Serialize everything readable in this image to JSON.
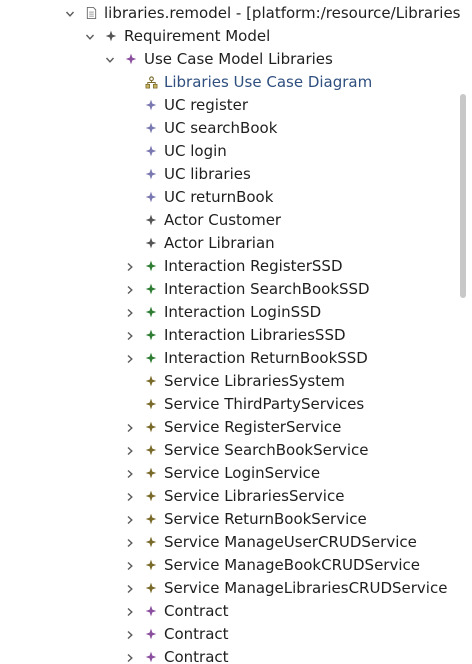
{
  "colors": {
    "interaction_icon": "#2e7d32",
    "service_icon": "#7a6a2a",
    "contract_icon": "#8a4f9e",
    "uc_icon": "#7a78b0",
    "actor_icon": "#555555",
    "diagram_text": "#2f4f7f"
  },
  "tree": {
    "rows": [
      {
        "label": "libraries.remodel - [platform:/resource/Libraries",
        "depth": 0,
        "expander": "expanded",
        "icon": "file-icon"
      },
      {
        "label": "Requirement Model",
        "depth": 1,
        "expander": "expanded",
        "icon": "model-icon"
      },
      {
        "label": "Use Case Model Libraries",
        "depth": 2,
        "expander": "expanded",
        "icon": "usecase-model-icon"
      },
      {
        "label": "Libraries Use Case Diagram",
        "depth": 3,
        "expander": "none",
        "icon": "diagram-icon"
      },
      {
        "label": "UC register",
        "depth": 3,
        "expander": "none",
        "icon": "use-case-icon"
      },
      {
        "label": "UC searchBook",
        "depth": 3,
        "expander": "none",
        "icon": "use-case-icon"
      },
      {
        "label": "UC login",
        "depth": 3,
        "expander": "none",
        "icon": "use-case-icon"
      },
      {
        "label": "UC libraries",
        "depth": 3,
        "expander": "none",
        "icon": "use-case-icon"
      },
      {
        "label": "UC returnBook",
        "depth": 3,
        "expander": "none",
        "icon": "use-case-icon"
      },
      {
        "label": "Actor Customer",
        "depth": 3,
        "expander": "none",
        "icon": "actor-icon"
      },
      {
        "label": "Actor Librarian",
        "depth": 3,
        "expander": "none",
        "icon": "actor-icon"
      },
      {
        "label": "Interaction RegisterSSD",
        "depth": 3,
        "expander": "collapsed",
        "icon": "interaction-icon"
      },
      {
        "label": "Interaction SearchBookSSD",
        "depth": 3,
        "expander": "collapsed",
        "icon": "interaction-icon"
      },
      {
        "label": "Interaction LoginSSD",
        "depth": 3,
        "expander": "collapsed",
        "icon": "interaction-icon"
      },
      {
        "label": "Interaction LibrariesSSD",
        "depth": 3,
        "expander": "collapsed",
        "icon": "interaction-icon"
      },
      {
        "label": "Interaction ReturnBookSSD",
        "depth": 3,
        "expander": "collapsed",
        "icon": "interaction-icon"
      },
      {
        "label": "Service LibrariesSystem",
        "depth": 3,
        "expander": "none",
        "icon": "service-icon"
      },
      {
        "label": "Service ThirdPartyServices",
        "depth": 3,
        "expander": "none",
        "icon": "service-icon"
      },
      {
        "label": "Service RegisterService",
        "depth": 3,
        "expander": "collapsed",
        "icon": "service-icon"
      },
      {
        "label": "Service SearchBookService",
        "depth": 3,
        "expander": "collapsed",
        "icon": "service-icon"
      },
      {
        "label": "Service LoginService",
        "depth": 3,
        "expander": "collapsed",
        "icon": "service-icon"
      },
      {
        "label": "Service LibrariesService",
        "depth": 3,
        "expander": "collapsed",
        "icon": "service-icon"
      },
      {
        "label": "Service ReturnBookService",
        "depth": 3,
        "expander": "collapsed",
        "icon": "service-icon"
      },
      {
        "label": "Service ManageUserCRUDService",
        "depth": 3,
        "expander": "collapsed",
        "icon": "service-icon"
      },
      {
        "label": "Service ManageBookCRUDService",
        "depth": 3,
        "expander": "collapsed",
        "icon": "service-icon"
      },
      {
        "label": "Service ManageLibrariesCRUDService",
        "depth": 3,
        "expander": "collapsed",
        "icon": "service-icon"
      },
      {
        "label": "Contract",
        "depth": 3,
        "expander": "collapsed",
        "icon": "contract-icon"
      },
      {
        "label": "Contract",
        "depth": 3,
        "expander": "collapsed",
        "icon": "contract-icon"
      },
      {
        "label": "Contract",
        "depth": 3,
        "expander": "collapsed",
        "icon": "contract-icon"
      }
    ]
  }
}
